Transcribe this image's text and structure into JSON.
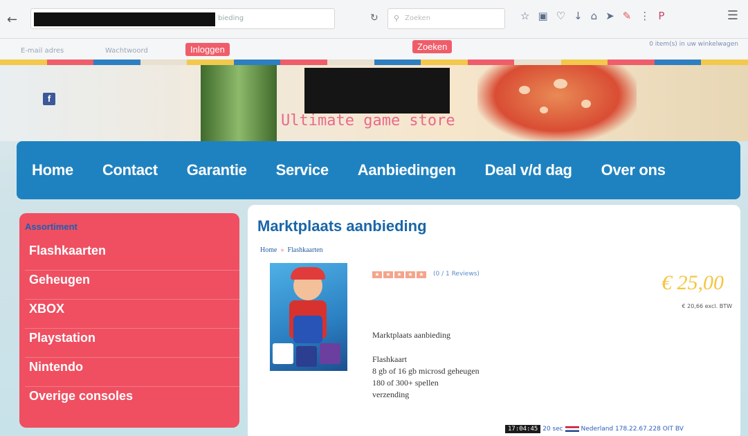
{
  "browser": {
    "url_tail": "bieding",
    "search_placeholder": "Zoeken"
  },
  "topbar": {
    "email_placeholder": "E-mail adres",
    "password_placeholder": "Wachtwoord",
    "login_label": "Inloggen",
    "search_label": "Zoeken",
    "cart_text": "0 item(s) in uw winkelwagen"
  },
  "banner": {
    "slogan": "Ultimate game store"
  },
  "nav": {
    "items": [
      "Home",
      "Contact",
      "Garantie",
      "Service",
      "Aanbiedingen",
      "Deal v/d dag",
      "Over ons"
    ]
  },
  "sidebar": {
    "title": "Assortiment",
    "items": [
      "Flashkaarten",
      "Geheugen",
      "XBOX",
      "Playstation",
      "Nintendo",
      "Overige consoles"
    ]
  },
  "product": {
    "title": "Marktplaats aanbieding",
    "breadcrumb": [
      "Home",
      "Flashkaarten"
    ],
    "reviews": "(0 / 1 Reviews)",
    "price": "€ 25,00",
    "tax_note": "€ 20,66 excl. BTW",
    "desc_title": "Marktplaats aanbieding",
    "desc_lines": [
      "Flashkaart",
      "8 gb of 16 gb microsd geheugen",
      "180 of 300+ spellen",
      "verzending"
    ]
  },
  "taskbar": {
    "clock": "17:04:45",
    "status": "20 sec",
    "country": "Nederland",
    "ip": "178.22.67.228 OIT BV"
  }
}
